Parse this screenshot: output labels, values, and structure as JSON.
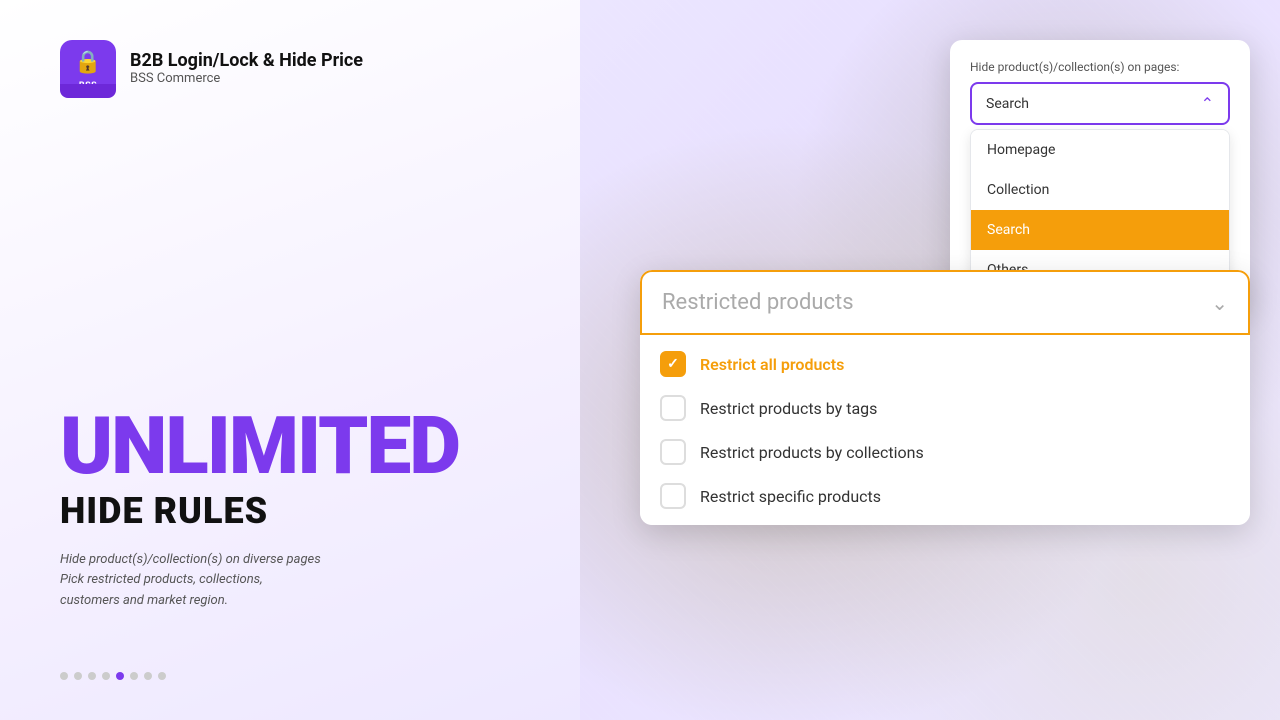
{
  "logo": {
    "icon_symbol": "🔒",
    "bss_label": "BSS",
    "app_name": "B2B Login/Lock & Hide Price",
    "company": "BSS Commerce"
  },
  "hero": {
    "unlimited": "UNLIMITED",
    "hide_rules": "HIDE RULES",
    "description_line1": "Hide product(s)/collection(s) on diverse pages",
    "description_line2": "Pick restricted products, collections,",
    "description_line3": "customers and market region."
  },
  "pagination": {
    "total": 8,
    "active_index": 4
  },
  "dropdown_card": {
    "label": "Hide product(s)/collection(s) on pages:",
    "selected_value": "Search",
    "options": [
      {
        "label": "Homepage",
        "active": false
      },
      {
        "label": "Collection",
        "active": false
      },
      {
        "label": "Search",
        "active": true
      },
      {
        "label": "Others",
        "active": false
      }
    ]
  },
  "restricted_card": {
    "title": "Restricted products",
    "chevron": "›",
    "options": [
      {
        "label": "Restrict all products",
        "checked": true
      },
      {
        "label": "Restrict products by tags",
        "checked": false
      },
      {
        "label": "Restrict products by collections",
        "checked": false
      },
      {
        "label": "Restrict specific products",
        "checked": false
      }
    ]
  },
  "colors": {
    "brand_purple": "#7c3aed",
    "brand_orange": "#f59e0b",
    "text_dark": "#111111",
    "text_muted": "#555555"
  }
}
